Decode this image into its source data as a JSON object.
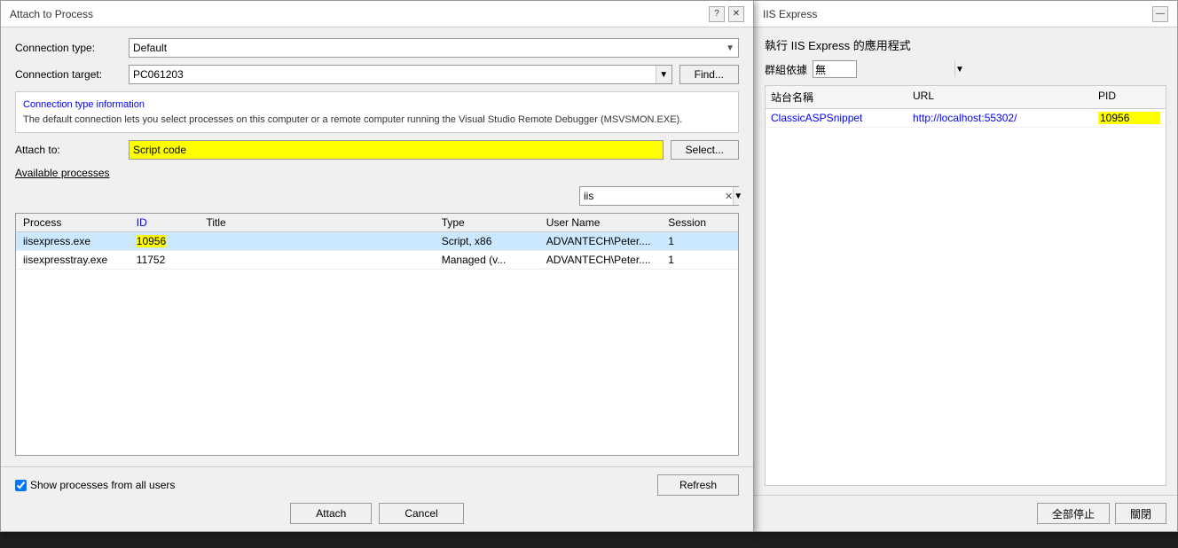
{
  "dialog": {
    "title": "Attach to Process",
    "connection_type_label": "Connection type:",
    "connection_type_value": "Default",
    "connection_target_label": "Connection target:",
    "connection_target_value": "PC061203",
    "find_btn": "Find...",
    "info_title": "Connection type information",
    "info_text": "The default connection lets you select processes on this computer or a remote computer running the Visual Studio Remote Debugger (MSVSMON.EXE).",
    "attach_to_label": "Attach to:",
    "attach_to_value": "Script code",
    "select_btn": "Select...",
    "available_processes": "Available processes",
    "filter_value": "iis",
    "columns": {
      "process": "Process",
      "id": "ID",
      "title": "Title",
      "type": "Type",
      "username": "User Name",
      "session": "Session"
    },
    "rows": [
      {
        "process": "iisexpress.exe",
        "id": "10956",
        "title": "",
        "type": "Script, x86",
        "username": "ADVANTECH\\Peter....",
        "session": "1",
        "selected": true
      },
      {
        "process": "iisexpresstray.exe",
        "id": "11752",
        "title": "",
        "type": "Managed (v...",
        "username": "ADVANTECH\\Peter....",
        "session": "1",
        "selected": false
      }
    ],
    "show_processes_label": "Show processes from all users",
    "show_processes_checked": true,
    "refresh_btn": "Refresh",
    "attach_btn": "Attach",
    "cancel_btn": "Cancel",
    "help_btn": "?",
    "close_btn": "✕"
  },
  "iis": {
    "title": "IIS Express",
    "heading": "執行 IIS Express 的應用程式",
    "group_label": "群組依據",
    "group_value": "無",
    "columns": {
      "name": "站台名稱",
      "url": "URL",
      "pid": "PID"
    },
    "rows": [
      {
        "name": "ClassicASPSnippet",
        "url": "http://localhost:55302/",
        "pid": "10956"
      }
    ],
    "stop_all_btn": "全部停止",
    "close_btn": "關閉",
    "minimize_btn": "—"
  }
}
